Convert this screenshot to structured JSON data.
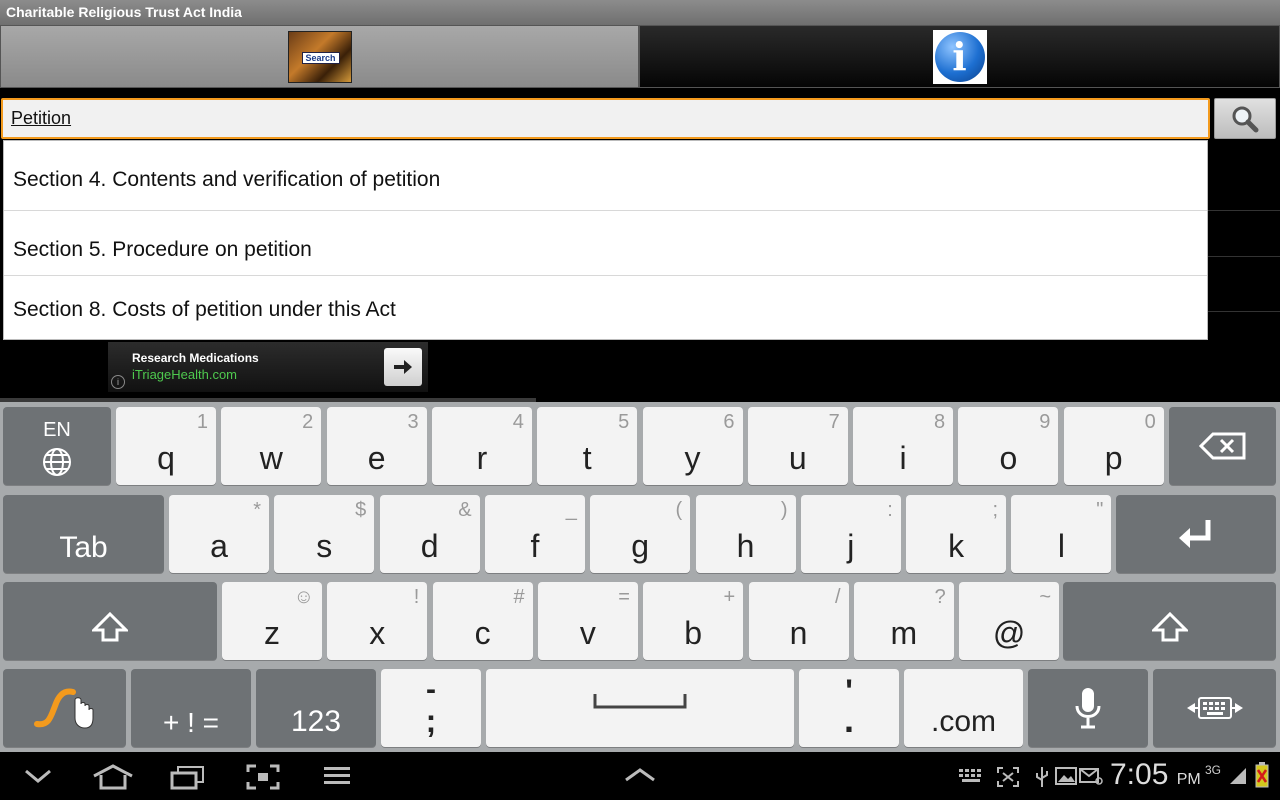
{
  "app": {
    "title": "Charitable Religious Trust Act India"
  },
  "tabs": {
    "search_thumb_label": "Search",
    "info_glyph": "i"
  },
  "search": {
    "query": "Petition",
    "button_icon": "magnifier-icon"
  },
  "suggestions": [
    "Section 4. Contents and verification of petition",
    "Section 5. Procedure on petition",
    "Section 8. Costs of petition under this Act"
  ],
  "ad": {
    "title": "Research Medications",
    "url": "iTriageHealth.com",
    "info": "i"
  },
  "keyboard": {
    "language": "EN",
    "row1": [
      {
        "key": "q",
        "alt": "1"
      },
      {
        "key": "w",
        "alt": "2"
      },
      {
        "key": "e",
        "alt": "3"
      },
      {
        "key": "r",
        "alt": "4"
      },
      {
        "key": "t",
        "alt": "5"
      },
      {
        "key": "y",
        "alt": "6"
      },
      {
        "key": "u",
        "alt": "7"
      },
      {
        "key": "i",
        "alt": "8"
      },
      {
        "key": "o",
        "alt": "9"
      },
      {
        "key": "p",
        "alt": "0"
      }
    ],
    "tab": "Tab",
    "row2": [
      {
        "key": "a",
        "alt": "*"
      },
      {
        "key": "s",
        "alt": "$"
      },
      {
        "key": "d",
        "alt": "&"
      },
      {
        "key": "f",
        "alt": "_"
      },
      {
        "key": "g",
        "alt": "("
      },
      {
        "key": "h",
        "alt": ")"
      },
      {
        "key": "j",
        "alt": ":"
      },
      {
        "key": "k",
        "alt": ";"
      },
      {
        "key": "l",
        "alt": "\""
      }
    ],
    "row3": [
      {
        "key": "z",
        "alt": "☺"
      },
      {
        "key": "x",
        "alt": "!"
      },
      {
        "key": "c",
        "alt": "#"
      },
      {
        "key": "v",
        "alt": "="
      },
      {
        "key": "b",
        "alt": "+"
      },
      {
        "key": "n",
        "alt": "/"
      },
      {
        "key": "m",
        "alt": "?"
      },
      {
        "key": "@",
        "alt": "~"
      }
    ],
    "sym_key": "+ ! =",
    "num_key": "123",
    "dash_key_top": "-",
    "dash_key_bottom": ";",
    "quote_key_top": "'",
    "quote_key_bottom": ".",
    "com_key": ".com"
  },
  "status": {
    "time": "7:05",
    "ampm": "PM",
    "network": "3G"
  }
}
